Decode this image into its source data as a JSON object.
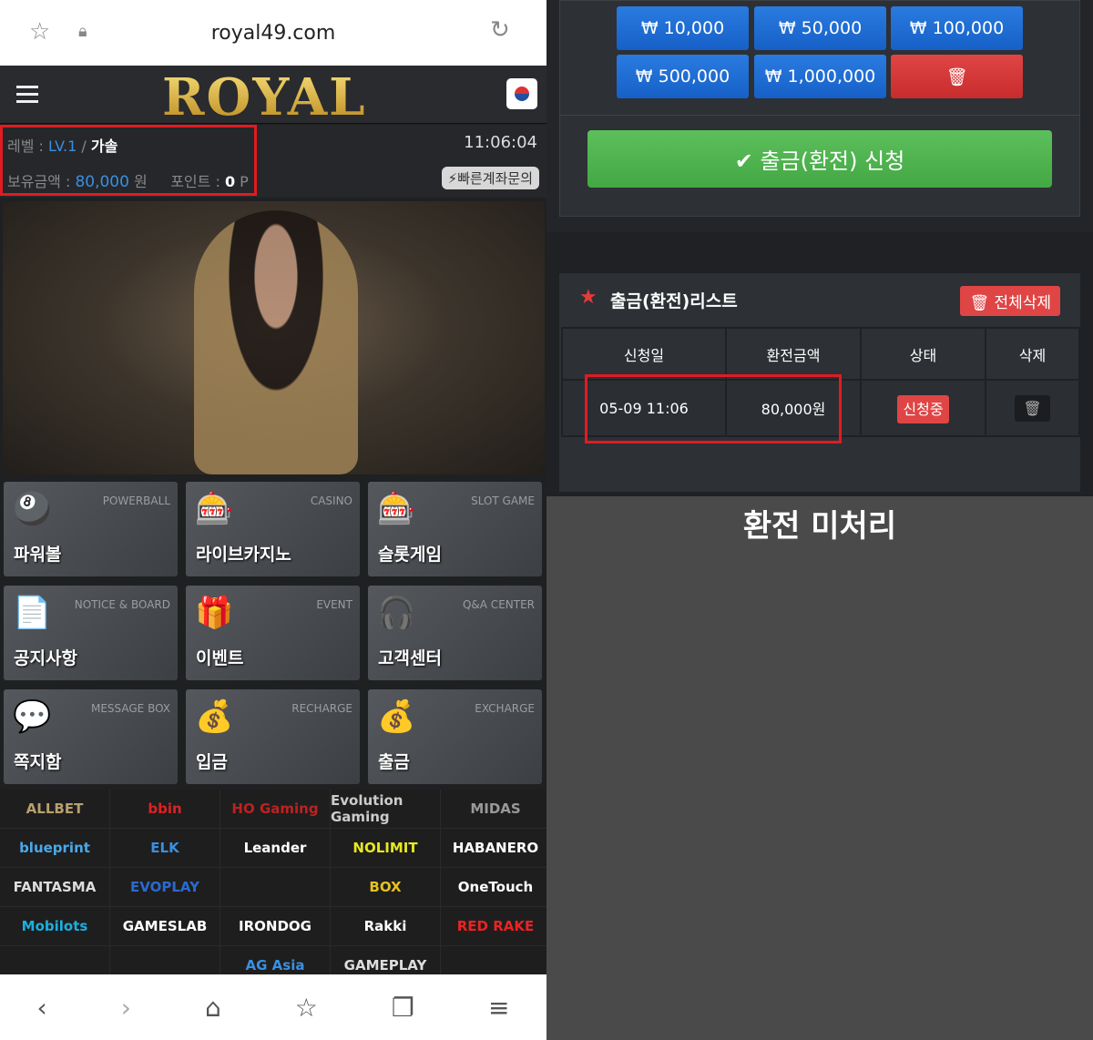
{
  "browser": {
    "url": "royal49.com",
    "icons": [
      "star-icon",
      "lock-icon",
      "reload-icon"
    ]
  },
  "header": {
    "logo": "ROYAL",
    "flag": "korea-flag-icon"
  },
  "info": {
    "level_label": "레벨 :",
    "level": "LV.1",
    "sep": "/",
    "nickname": "가솔",
    "time": "11:06:04",
    "balance_label": "보유금액 :",
    "balance": "80,000",
    "balance_unit": "원",
    "points_label": "포인트 :",
    "points": "0",
    "points_unit": "P",
    "quick_button": "빠른계좌문의"
  },
  "tiles": [
    {
      "en": "POWERBALL",
      "ko": "파워볼",
      "icon": "🎱"
    },
    {
      "en": "CASINO",
      "ko": "라이브카지노",
      "icon": "🎰"
    },
    {
      "en": "SLOT GAME",
      "ko": "슬롯게임",
      "icon": "🎰"
    },
    {
      "en": "NOTICE & BOARD",
      "ko": "공지사항",
      "icon": "📄"
    },
    {
      "en": "EVENT",
      "ko": "이벤트",
      "icon": "🎁"
    },
    {
      "en": "Q&A CENTER",
      "ko": "고객센터",
      "icon": "🎧"
    },
    {
      "en": "MESSAGE BOX",
      "ko": "쪽지함",
      "icon": "💬"
    },
    {
      "en": "RECHARGE",
      "ko": "입금",
      "icon": "💰"
    },
    {
      "en": "EXCHARGE",
      "ko": "출금",
      "icon": "💰"
    }
  ],
  "providers": [
    {
      "name": "ALLBET",
      "color": "#b8a070"
    },
    {
      "name": "bbin",
      "color": "#d22"
    },
    {
      "name": "HO Gaming",
      "color": "#b22"
    },
    {
      "name": "Evolution Gaming",
      "color": "#ccc"
    },
    {
      "name": "MIDAS",
      "color": "#999"
    },
    {
      "name": "blueprint",
      "color": "#4aa8e8"
    },
    {
      "name": "ELK",
      "color": "#3a8fe0"
    },
    {
      "name": "Leander",
      "color": "#fff"
    },
    {
      "name": "NOLIMIT",
      "color": "#e8e820"
    },
    {
      "name": "HABANERO",
      "color": "#fff"
    },
    {
      "name": "FANTASMA",
      "color": "#ddd"
    },
    {
      "name": "EVOPLAY",
      "color": "#2a6ad0"
    },
    {
      "name": "",
      "color": "#345"
    },
    {
      "name": "BOX",
      "color": "#e8c020"
    },
    {
      "name": "OneTouch",
      "color": "#fff"
    },
    {
      "name": "Mobilots",
      "color": "#1ab0e0"
    },
    {
      "name": "GAMESLAB",
      "color": "#fff"
    },
    {
      "name": "IRONDOG",
      "color": "#fff"
    },
    {
      "name": "Rakki",
      "color": "#fff"
    },
    {
      "name": "RED RAKE",
      "color": "#e22"
    },
    {
      "name": "",
      "color": "#e8c020"
    },
    {
      "name": "",
      "color": "#2c8"
    },
    {
      "name": "AG Asia",
      "color": "#3a8fe0"
    },
    {
      "name": "GAMEPLAY",
      "color": "#ddd"
    },
    {
      "name": "",
      "color": "#e62"
    }
  ],
  "bottom_nav": [
    "back-icon",
    "forward-icon",
    "home-icon",
    "bookmarks-icon",
    "tabs-icon",
    "menu-icon"
  ],
  "withdraw": {
    "amounts": [
      "₩ 10,000",
      "₩ 50,000",
      "₩ 100,000",
      "₩ 500,000",
      "₩ 1,000,000"
    ],
    "delete_icon": "trash-icon",
    "submit": "✔ 출금(환전) 신청"
  },
  "list": {
    "title": "출금(환전)리스트",
    "delete_all": "🗑 전체삭제",
    "headers": [
      "신청일",
      "환전금액",
      "상태",
      "삭제"
    ],
    "rows": [
      {
        "date": "05-09 11:06",
        "amount": "80,000원",
        "status": "신청중"
      }
    ]
  },
  "caption": "환전 미처리"
}
